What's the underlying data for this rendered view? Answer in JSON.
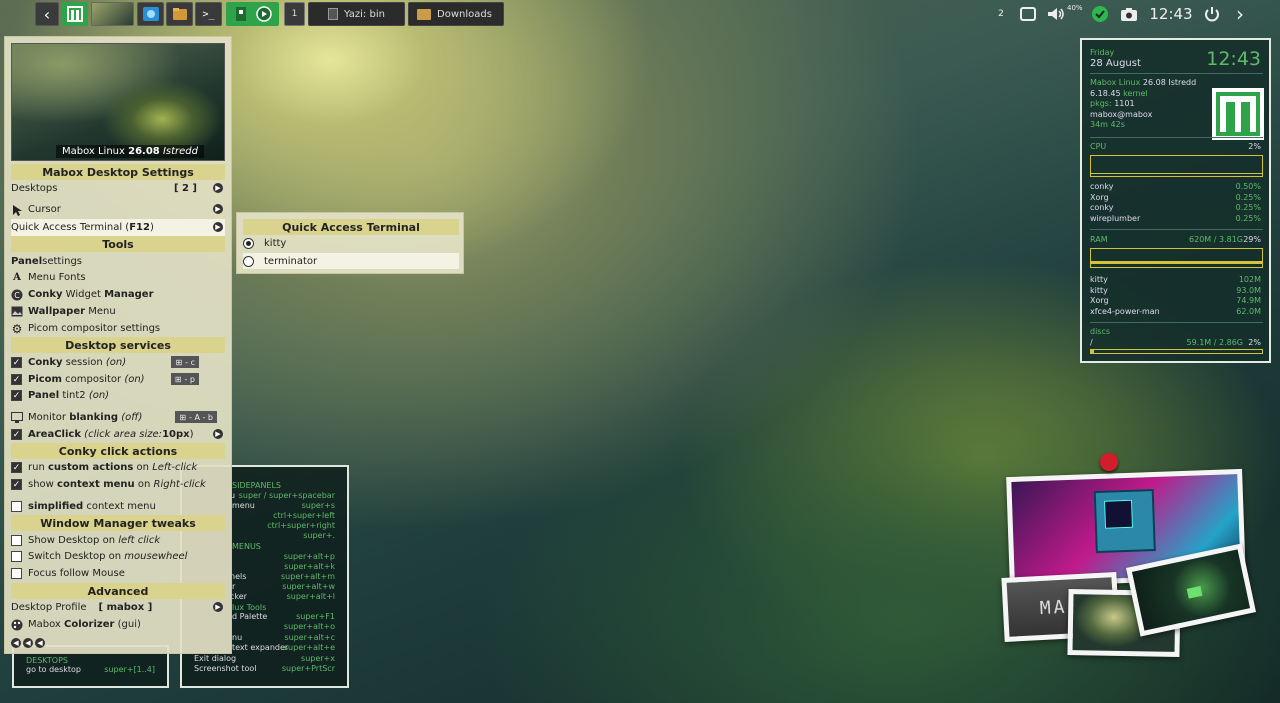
{
  "taskbar": {
    "win1": "Yazi: bin",
    "win2": "Downloads",
    "workspace": "1"
  },
  "tray": {
    "ws": "2",
    "vol": "40%",
    "clock": "12:43"
  },
  "menu": {
    "caption_a": "Mabox Linux",
    "caption_b": "26.08",
    "caption_c": "Istredd",
    "sec1": "Mabox Desktop Settings",
    "desktops": "Desktops",
    "desktops_val": "[ 2 ]",
    "cursor": "Cursor",
    "qat_a": "Quick Access Terminal (",
    "qat_b": "F12",
    ")": ")",
    "sec2": "Tools",
    "panel_b": "Panel",
    "panel_t": " settings",
    "menufonts": "Menu Fonts",
    "conky_b": "Conky",
    "conky_t": " Widget ",
    "conky_b2": "Manager",
    "wall_b": "Wallpaper",
    "wall_t": " Menu",
    "picom": "Picom compositor settings",
    "sec3": "Desktop services",
    "s1_b": "Conky",
    "s1_t": " session ",
    "s1_i": "(on)",
    "s1_k": "- c",
    "s2_b": "Picom",
    "s2_t": " compositor ",
    "s2_i": "(on)",
    "s2_k": "- p",
    "s3_b": "Panel",
    "s3_t": " tint2 ",
    "s3_i": "(on)",
    "s4_t": "Monitor ",
    "s4_b": "blanking",
    "s4_i": "(off)",
    "s4_k": "- A - b",
    "s5_b": "AreaClick",
    "s5_i": "(click area size: ",
    "s5_b2": "10px",
    "s5_e": ")",
    "sec4": "Conky click actions",
    "c1_t": "run ",
    "c1_b": "custom actions",
    "c1_t2": " on ",
    "c1_i": "Left-click",
    "c2_t": "show ",
    "c2_b": "context menu",
    "c2_t2": " on ",
    "c2_i": "Right-click",
    "c3_b": "simplified",
    "c3_t": " context menu",
    "sec5": "Window Manager tweaks",
    "w1_t": "Show Desktop on ",
    "w1_i": "left click",
    "w2_t": "Switch Desktop on ",
    "w2_i": "mousewheel",
    "w3": "Focus follow Mouse",
    "sec6": "Advanced",
    "a1": "Desktop Profile",
    "a1_v": "[ mabox ]",
    "a2_t": "Mabox ",
    "a2_b": "Colorizer",
    "a2_i": " (gui)"
  },
  "submenu": {
    "title": "Quick Access Terminal",
    "opt1": "kitty",
    "opt2": "terminator"
  },
  "keys_left": {
    "head": "DESKTOPS",
    "l1": "go to desktop",
    "r1": "super+[1..4]"
  },
  "keys_right": {
    "h1": "SIDEPANELS",
    "r1": "super / super+spacebar",
    "l1a": "u",
    "l2": "menu",
    "r2": "super+s",
    "r3": "ctrl+super+left",
    "r4": "ctrl+super+right",
    "r5": "super+.",
    "h2": "MENUS",
    "r6": "super+alt+p",
    "r7": "super+alt+k",
    "l8": "nels",
    "r8": "super+alt+m",
    "l9": "r",
    "r9": "super+alt+w",
    "l10": "cker",
    "r10": "super+alt+l",
    "h3": "lux Tools",
    "l11": "d Palette",
    "r11": "super+F1",
    "r12": "super+alt+o",
    "l13": "nu",
    "r13": "super+alt+c",
    "l14": "text expander",
    "r14": "super+alt+e",
    "l15": "Exit dialog",
    "r15": "super+x",
    "l16": "Screenshot tool",
    "r16": "super+PrtScr"
  },
  "conky": {
    "day": "Friday",
    "date": "28 August",
    "time": "12:43",
    "os_a": "Mabox Linux ",
    "os_b": "26.08 Istredd",
    "kernel_a": "6.18.45 ",
    "kernel_b": "kernel",
    "pkgs_a": "pkgs: ",
    "pkgs_b": "1101",
    "user": "mabox@mabox",
    "uptime": "34m 42s",
    "cpu_label": "CPU",
    "cpu_pct": "2%",
    "cpu_value": 0.02,
    "procs": [
      {
        "n": "conky",
        "v": "0.50%"
      },
      {
        "n": "Xorg",
        "v": "0.25%"
      },
      {
        "n": "conky",
        "v": "0.25%"
      },
      {
        "n": "wireplumber",
        "v": "0.25%"
      }
    ],
    "ram_label": "RAM",
    "ram_used": "620M / 3.81G",
    "ram_pct": "29%",
    "ram_value": 0.29,
    "mem": [
      {
        "n": "kitty",
        "v": "102M"
      },
      {
        "n": "kitty",
        "v": "93.0M"
      },
      {
        "n": "Xorg",
        "v": "74.9M"
      },
      {
        "n": "xfce4-power-man",
        "v": "62.0M"
      }
    ],
    "disk_label": "discs",
    "disk_mount": "/",
    "disk_used": "59.1M / 2.86G",
    "disk_pct": "2%",
    "disk_value": 0.02
  },
  "polaroid_logo": "MAB"
}
